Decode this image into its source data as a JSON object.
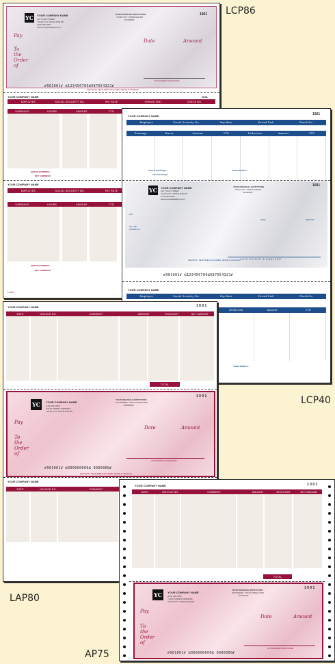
{
  "labels": {
    "lcp86": "LCP86",
    "lcp40": "LCP40",
    "lap80": "LAP80",
    "ap75": "AP75"
  },
  "colors": {
    "maroon": "#97123a",
    "blue": "#1c4d8c",
    "background": "#fcf3d2"
  },
  "company": {
    "name": "YOUR COMPANY NAME",
    "street": "123 YOUR STREET",
    "city": "YOUR CITY, STATE AND ZIP",
    "phone": "(123) 456-7890",
    "web": "www.yourwebaddress.com",
    "street_alt": "YOUR STREET ADDRESS",
    "initials": "YC"
  },
  "bank": {
    "name": "YOUR FINANCIAL INSTITUTION",
    "city": "YOUR CITY, STATE AND ZIP",
    "code": "00-000000",
    "city_alt": "ANYWHERE, YOUR STATE 12345"
  },
  "check_no": "1001",
  "check_no_spaced": "1 0 0 1",
  "check_text": {
    "pay": "Pay",
    "to_order": "To the Order of",
    "date": "Date",
    "amount": "Amount",
    "signature": "AUTHORIZED SIGNATURE",
    "security": "SECURITY FEATURES INCLUDED. DETAILS ON BACK.",
    "pay_caps": "PAY",
    "to_order_caps": "TO THE ORDER OF",
    "date_caps": "DATE",
    "amount_caps": "AMOUNT",
    "signature_spaced": "A U T H O R I Z E D   S I G N A T U R E"
  },
  "micr": {
    "lcp": "⑈001001⑈ ⑆123456789⑆987654321⑈",
    "ap": "⑈001001⑈ ⑆000000000⑆ 0000000⑈"
  },
  "payroll_headers": [
    "EMPLOYEE",
    "SOCIAL SECURITY NO.",
    "PAY RATE",
    "PERIOD END",
    "CHECK NO."
  ],
  "payroll_headers_serif": [
    "Employee",
    "Social Security No.",
    "Pay Rate",
    "Period End.",
    "Check No."
  ],
  "earnings_headers": [
    "EARNINGS",
    "HOURS",
    "AMOUNT",
    "YTD",
    "DEDUCTION",
    "AMOUNT",
    "YTD"
  ],
  "earnings_headers_serif": [
    "Earnings",
    "Hours",
    "Amount",
    "YTD",
    "Deduction",
    "Amount",
    "YTD"
  ],
  "totals": {
    "gross": "GROSS EARNINGS:",
    "net": "NET EARNINGS:",
    "deduct": "TOTAL DEDUCT.:",
    "gross_serif": "Gross Earnings:",
    "net_serif": "Net Earnings:",
    "deduct_serif": "Total Deduct.:"
  },
  "ap_headers": [
    "DATE",
    "INVOICE NO.",
    "COMMENT",
    "AMOUNT",
    "DISCOUNT",
    "NET AMOUNT"
  ],
  "ap_total": "TOTAL",
  "corner_code": "LCP86"
}
